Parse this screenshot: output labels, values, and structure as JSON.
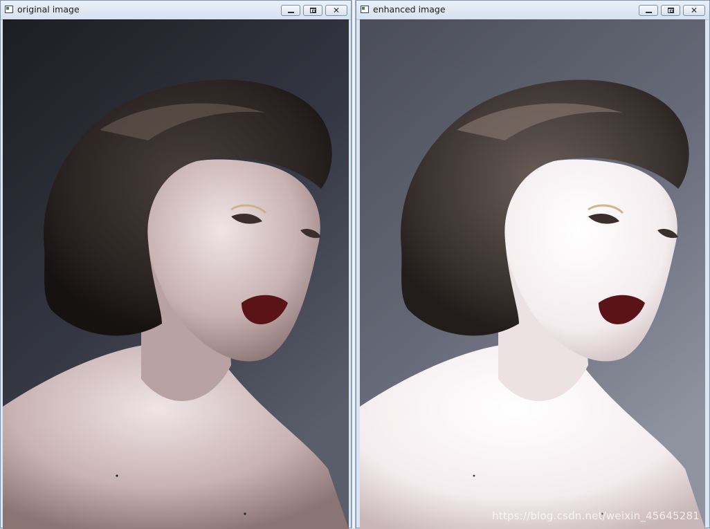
{
  "windows": [
    {
      "title": "original image",
      "icon": "app-window-icon",
      "controls": {
        "minimize": "minimize-icon",
        "maximize": "maximize-icon",
        "close": "close-icon"
      }
    },
    {
      "title": "enhanced image",
      "icon": "app-window-icon",
      "controls": {
        "minimize": "minimize-icon",
        "maximize": "maximize-icon",
        "close": "close-icon"
      }
    }
  ],
  "watermark": "https://blog.csdn.net/weixin_45645281",
  "colors": {
    "original_background": "#2a2d36",
    "enhanced_background": "#5d616f",
    "hair": "#2b2522",
    "lips": "#5a1418"
  }
}
